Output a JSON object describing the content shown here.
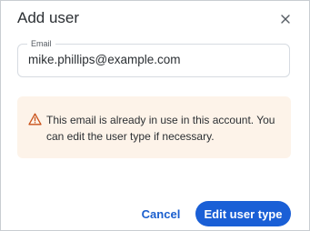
{
  "dialog": {
    "title": "Add user",
    "close_icon": "close-icon"
  },
  "email_field": {
    "label": "Email",
    "value": "mike.phillips@example.com"
  },
  "alert": {
    "icon": "warning-icon",
    "message": "This email is already in use in this account. You can edit the user type if necessary."
  },
  "actions": {
    "cancel_label": "Cancel",
    "primary_label": "Edit user type"
  },
  "colors": {
    "primary": "#1a5fd6",
    "alert_background": "#fdf3e9",
    "warning": "#c9521a"
  }
}
